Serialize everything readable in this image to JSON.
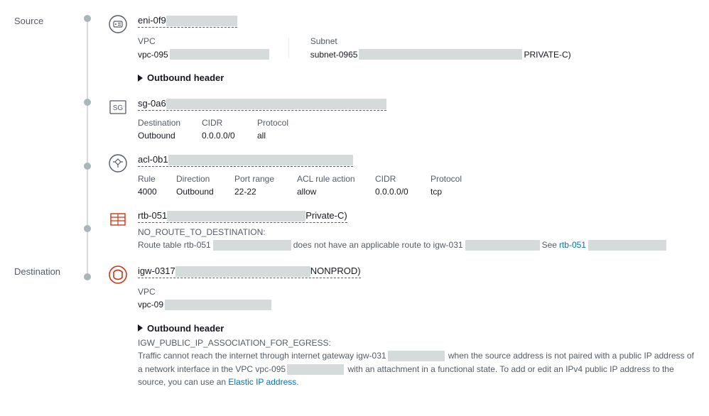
{
  "labels": {
    "source": "Source",
    "destination": "Destination"
  },
  "step_eni": {
    "title_pre": "eni-0f9",
    "vpc": {
      "label": "VPC",
      "value_pre": "vpc-095"
    },
    "subnet": {
      "label": "Subnet",
      "value_pre": "subnet-0965",
      "value_suf": "PRIVATE-C)"
    },
    "outbound_header": "Outbound header"
  },
  "step_sg": {
    "title_pre": "sg-0a6",
    "table": {
      "headers": {
        "dest": "Destination",
        "cidr": "CIDR",
        "proto": "Protocol"
      },
      "row": {
        "dest": "Outbound",
        "cidr": "0.0.0.0/0",
        "proto": "all"
      }
    }
  },
  "step_acl": {
    "title_pre": "acl-0b1",
    "table": {
      "headers": {
        "rule": "Rule",
        "dir": "Direction",
        "ports": "Port range",
        "action": "ACL rule action",
        "cidr": "CIDR",
        "proto": "Protocol"
      },
      "row": {
        "rule": "4000",
        "dir": "Outbound",
        "ports": "22-22",
        "action": "allow",
        "cidr": "0.0.0.0/0",
        "proto": "tcp"
      }
    }
  },
  "step_rtb": {
    "title_pre": "rtb-051",
    "title_suf": "Private-C)",
    "err_code": "NO_ROUTE_TO_DESTINATION:",
    "err_pre": "Route table rtb-051",
    "err_mid1": "does not have an applicable route to igw-031",
    "err_see": "See ",
    "err_link_pre": "rtb-051"
  },
  "step_igw": {
    "title_pre": "igw-0317",
    "title_suf": "NONPROD)",
    "vpc": {
      "label": "VPC",
      "value_pre": "vpc-09"
    },
    "outbound_header": "Outbound header",
    "err_code": "IGW_PUBLIC_IP_ASSOCIATION_FOR_EGRESS:",
    "err_a": "Traffic cannot reach the internet through internet gateway igw-031",
    "err_b": "when the source address is not paired with a public IP address of a network interface in the VPC vpc-095",
    "err_c": "with an attachment in a functional state. To add or edit an IPv4 public IP address to the source, you can use an ",
    "err_link": "Elastic IP address."
  }
}
